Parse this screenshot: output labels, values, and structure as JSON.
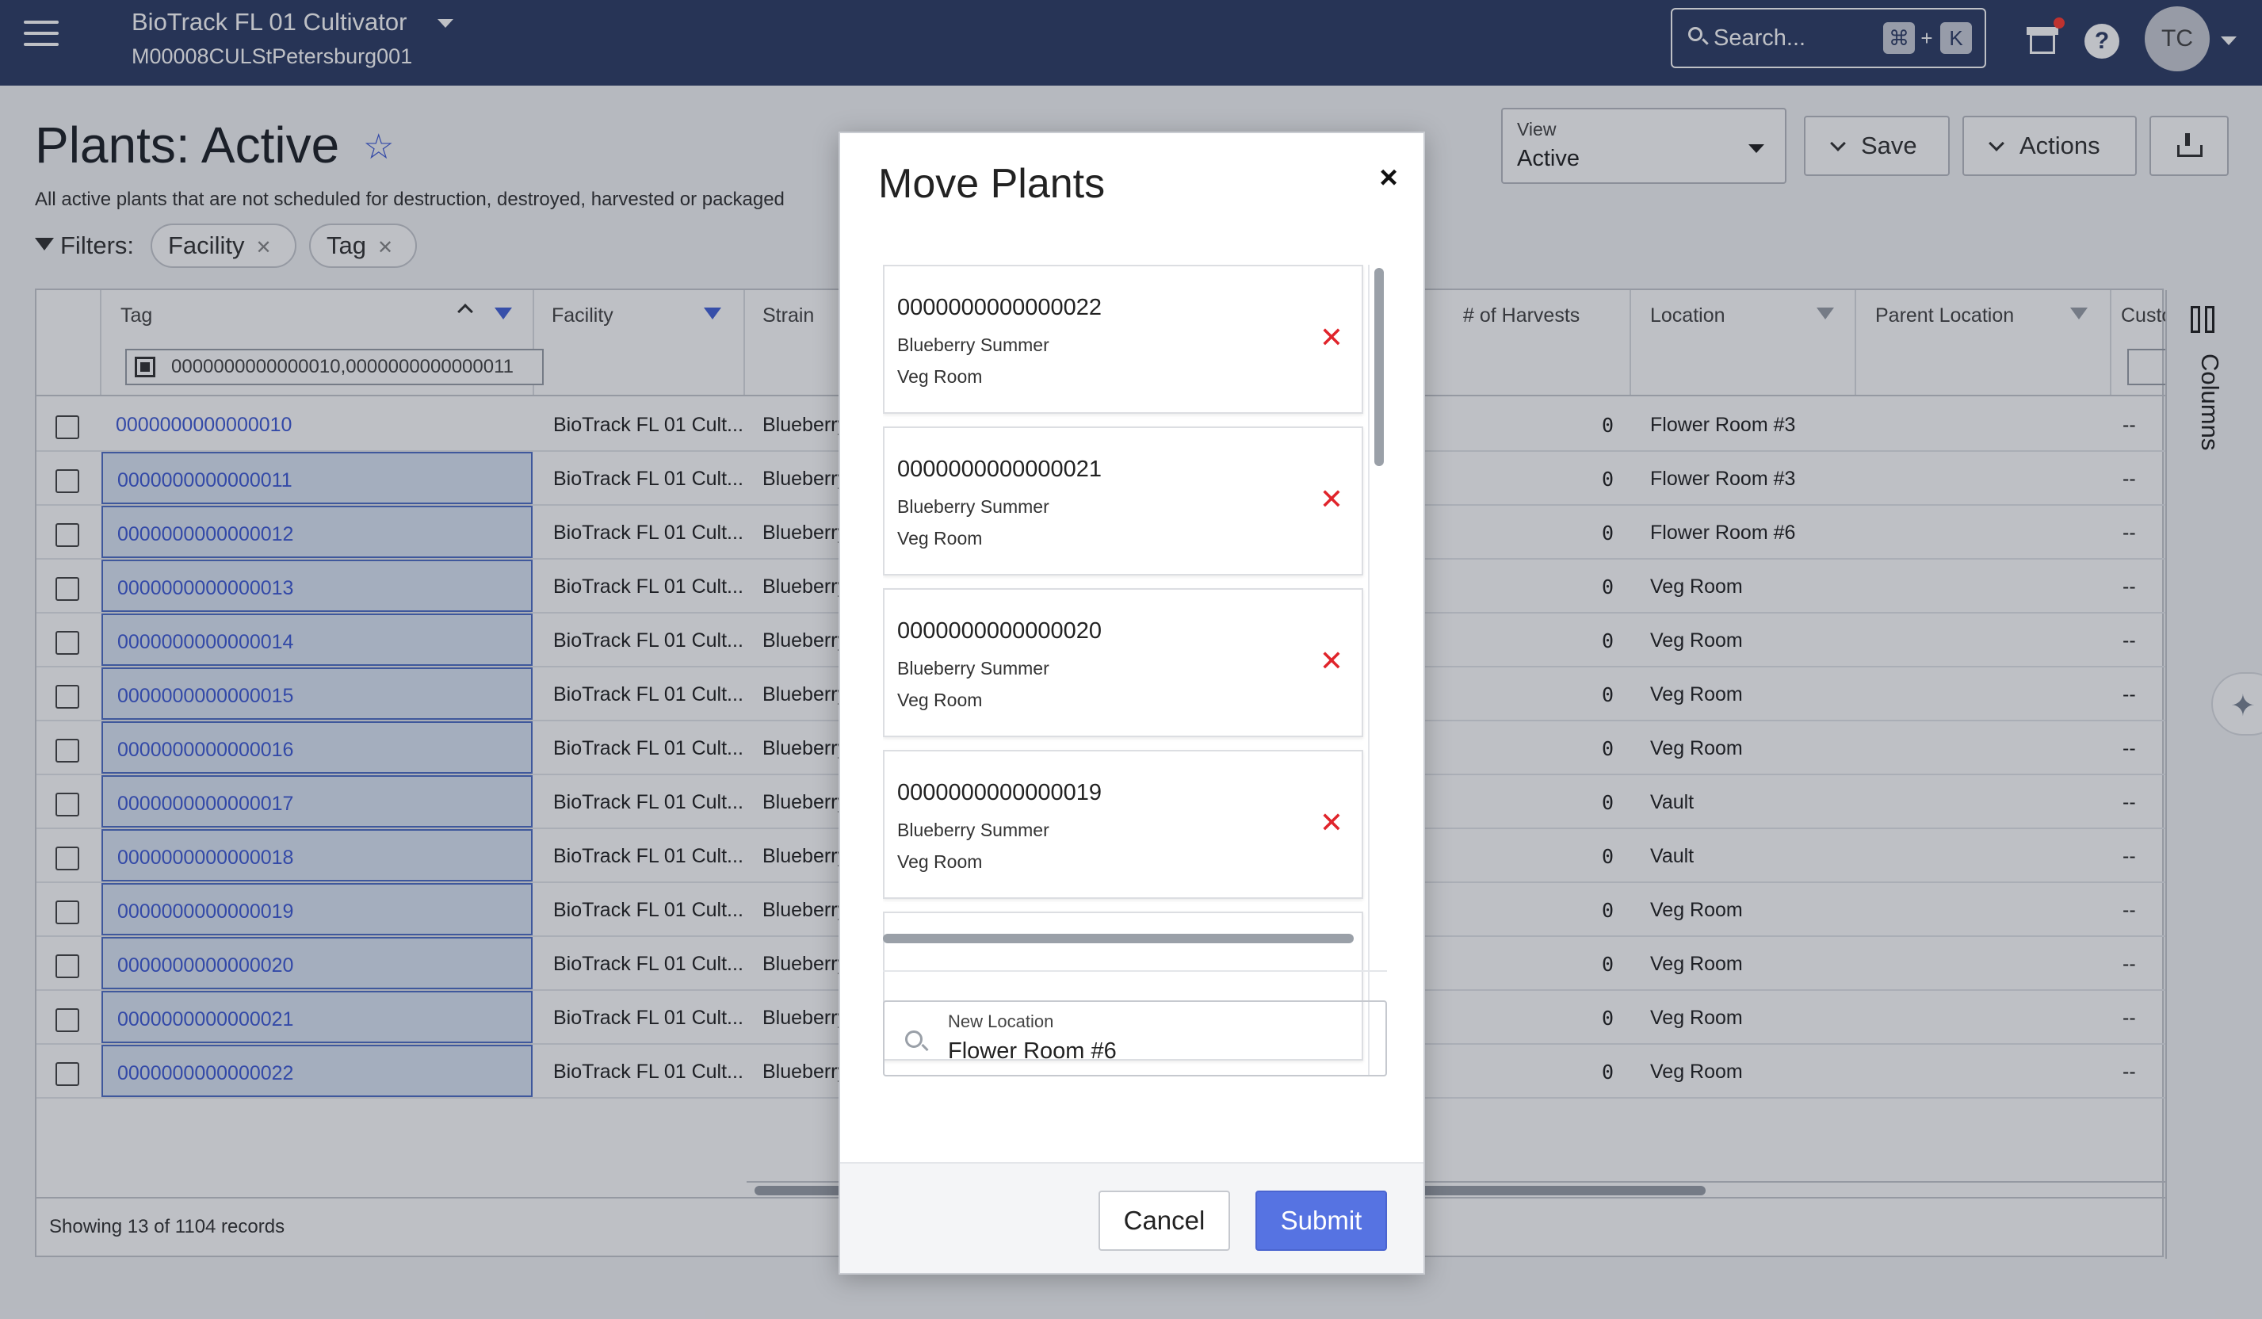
{
  "topbar": {
    "app_title": "BioTrack FL 01 Cultivator",
    "app_subtitle": "M00008CULStPetersburg001",
    "search_placeholder": "Search...",
    "shortcut_cmd": "⌘",
    "shortcut_plus": "+",
    "shortcut_key": "K",
    "help_label": "?",
    "avatar_initials": "TC"
  },
  "page": {
    "title": "Plants: Active",
    "description": "All active plants that are not scheduled for destruction, destroyed, harvested or packaged",
    "filters_label": "Filters:",
    "filter_chips": [
      "Facility",
      "Tag"
    ],
    "view_label": "View",
    "view_value": "Active",
    "save_label": "Save",
    "actions_label": "Actions"
  },
  "grid": {
    "columns": {
      "tag": "Tag",
      "facility": "Facility",
      "strain": "Strain",
      "harvests": "# of Harvests",
      "location": "Location",
      "parent_location": "Parent Location",
      "custom": "Custo"
    },
    "tag_filter_value": "0000000000000010,0000000000000011",
    "rows": [
      {
        "tag": "0000000000000010",
        "facility": "BioTrack FL 01 Cult...",
        "strain": "Blueberry",
        "harvests": "0",
        "location": "Flower Room #3",
        "custom": "--",
        "selected": false
      },
      {
        "tag": "0000000000000011",
        "facility": "BioTrack FL 01 Cult...",
        "strain": "Blueberry",
        "harvests": "0",
        "location": "Flower Room #3",
        "custom": "--",
        "selected": true
      },
      {
        "tag": "0000000000000012",
        "facility": "BioTrack FL 01 Cult...",
        "strain": "Blueberry",
        "harvests": "0",
        "location": "Flower Room #6",
        "custom": "--",
        "selected": true
      },
      {
        "tag": "0000000000000013",
        "facility": "BioTrack FL 01 Cult...",
        "strain": "Blueberry",
        "harvests": "0",
        "location": "Veg Room",
        "custom": "--",
        "selected": true
      },
      {
        "tag": "0000000000000014",
        "facility": "BioTrack FL 01 Cult...",
        "strain": "Blueberry",
        "harvests": "0",
        "location": "Veg Room",
        "custom": "--",
        "selected": true
      },
      {
        "tag": "0000000000000015",
        "facility": "BioTrack FL 01 Cult...",
        "strain": "Blueberry",
        "harvests": "0",
        "location": "Veg Room",
        "custom": "--",
        "selected": true
      },
      {
        "tag": "0000000000000016",
        "facility": "BioTrack FL 01 Cult...",
        "strain": "Blueberry",
        "harvests": "0",
        "location": "Veg Room",
        "custom": "--",
        "selected": true
      },
      {
        "tag": "0000000000000017",
        "facility": "BioTrack FL 01 Cult...",
        "strain": "Blueberry",
        "harvests": "0",
        "location": "Vault",
        "custom": "--",
        "selected": true
      },
      {
        "tag": "0000000000000018",
        "facility": "BioTrack FL 01 Cult...",
        "strain": "Blueberry",
        "harvests": "0",
        "location": "Vault",
        "custom": "--",
        "selected": true
      },
      {
        "tag": "0000000000000019",
        "facility": "BioTrack FL 01 Cult...",
        "strain": "Blueberry",
        "harvests": "0",
        "location": "Veg Room",
        "custom": "--",
        "selected": true
      },
      {
        "tag": "0000000000000020",
        "facility": "BioTrack FL 01 Cult...",
        "strain": "Blueberry",
        "harvests": "0",
        "location": "Veg Room",
        "custom": "--",
        "selected": true
      },
      {
        "tag": "0000000000000021",
        "facility": "BioTrack FL 01 Cult...",
        "strain": "Blueberry",
        "harvests": "0",
        "location": "Veg Room",
        "custom": "--",
        "selected": true
      },
      {
        "tag": "0000000000000022",
        "facility": "BioTrack FL 01 Cult...",
        "strain": "Blueberry",
        "harvests": "0",
        "location": "Veg Room",
        "custom": "--",
        "selected": true
      }
    ],
    "records_text": "Showing 13 of 1104 records",
    "columns_panel_label": "Columns"
  },
  "modal": {
    "title": "Move Plants",
    "close_label": "×",
    "plants": [
      {
        "tag": "0000000000000022",
        "strain": "Blueberry Summer",
        "location": "Veg Room"
      },
      {
        "tag": "0000000000000021",
        "strain": "Blueberry Summer",
        "location": "Veg Room"
      },
      {
        "tag": "0000000000000020",
        "strain": "Blueberry Summer",
        "location": "Veg Room"
      },
      {
        "tag": "0000000000000019",
        "strain": "Blueberry Summer",
        "location": "Veg Room"
      }
    ],
    "remove_label": "✕",
    "new_location_label": "New Location",
    "new_location_value": "Flower Room #6",
    "cancel_label": "Cancel",
    "submit_label": "Submit"
  },
  "colors": {
    "topbar": "#2e3d66",
    "link": "#3f5bd6",
    "selection_fill": "#dbe7f5",
    "submit": "#5673e2",
    "remove": "#e0242b"
  },
  "icons": [
    "menu-icon",
    "chevron-down-icon",
    "search-icon",
    "gift-icon",
    "help-icon",
    "star-icon",
    "filter-icon",
    "close-icon",
    "download-icon",
    "sort-ascending-icon",
    "barcode-scan-icon",
    "columns-icon",
    "sparkle-icon",
    "remove-icon"
  ]
}
